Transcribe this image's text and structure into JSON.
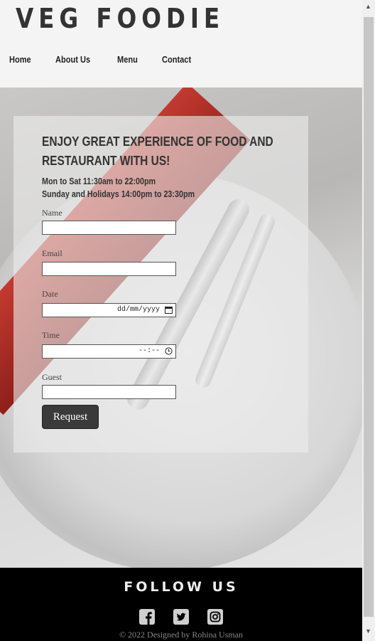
{
  "brand": {
    "title": "VEG FOODIE"
  },
  "nav": {
    "items": [
      "Home",
      "About Us",
      "Menu",
      "Contact"
    ]
  },
  "booking": {
    "heading": "ENJOY GREAT EXPERIENCE OF FOOD AND RESTAURANT WITH US!",
    "hours_weekday": "Mon to Sat 11:30am to 22:00pm",
    "hours_weekend": "Sunday and Holidays 14:00pm to 23:30pm",
    "name_label": "Name",
    "email_label": "Email",
    "date_label": "Date",
    "date_placeholder": "dd/mm/yyyy",
    "time_label": "Time",
    "time_placeholder": "--:--",
    "guest_label": "Guest",
    "submit_label": "Request"
  },
  "footer": {
    "follow_label": "FOLLOW US",
    "social_icons": [
      "facebook-icon",
      "twitter-icon",
      "instagram-icon"
    ],
    "copyright": "© 2022 Designed by Rohina Usman"
  }
}
